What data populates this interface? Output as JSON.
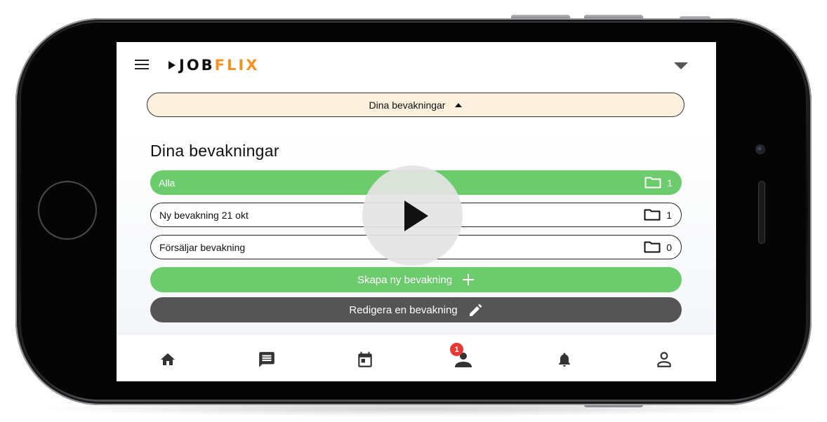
{
  "app": {
    "logo_prefix": "JOB",
    "logo_suffix": "FLIX"
  },
  "toggle": {
    "label": "Dina bevakningar"
  },
  "section": {
    "title": "Dina bevakningar"
  },
  "watchlists": [
    {
      "label": "Alla",
      "count": "1",
      "active": true
    },
    {
      "label": "Ny bevakning 21 okt",
      "count": "1",
      "active": false
    },
    {
      "label": "Försäljar bevakning",
      "count": "0",
      "active": false
    }
  ],
  "actions": {
    "create_label": "Skapa ny bevakning",
    "edit_label": "Redigera en bevakning"
  },
  "bottom_nav": {
    "items": [
      "home-icon",
      "chat-icon",
      "calendar-icon",
      "person-icon",
      "bell-icon",
      "profile-icon"
    ],
    "badge": "1"
  },
  "colors": {
    "accent_green": "#6ccb6c",
    "brand_orange": "#f59220",
    "dark_button": "#555555",
    "toggle_bg": "#fdf0dc",
    "badge_red": "#e53935"
  }
}
